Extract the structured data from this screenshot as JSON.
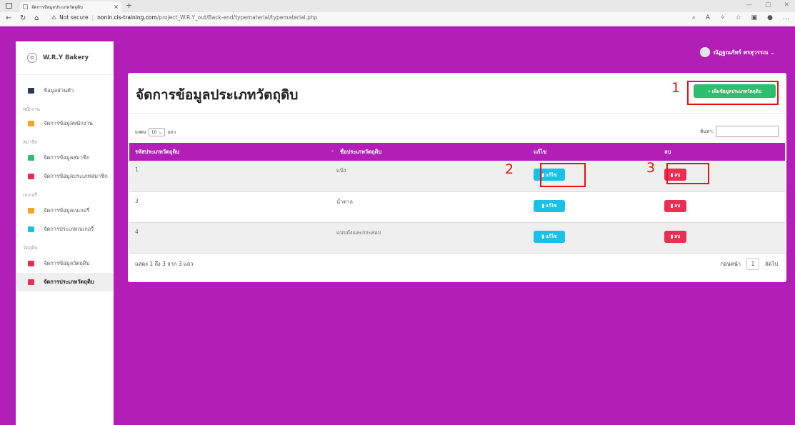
{
  "browser": {
    "tab_title": "จัดการข้อมูลประเภทวัตถุดิบ",
    "tab_close": "×",
    "new_tab": "+",
    "security": "Not secure",
    "url_host": "nonin.cis-training.com",
    "url_path": "/project_W.R.Y_out/Back-end/typematerial/typematerial.php"
  },
  "sidebar": {
    "brand": "W.R.Y Bakery",
    "items": [
      {
        "type": "item",
        "label": "ข้อมูลส่วนตัว",
        "icon": "id-card-icon",
        "color": "#2b3a55"
      },
      {
        "type": "section",
        "label": "พนักงาน"
      },
      {
        "type": "item",
        "label": "จัดการข้อมูลพนักงาน",
        "icon": "user-icon",
        "color": "#f5a623"
      },
      {
        "type": "section",
        "label": "สมาชิก"
      },
      {
        "type": "item",
        "label": "จัดการข้อมูลสมาชิก",
        "icon": "users-icon",
        "color": "#2dbd6e"
      },
      {
        "type": "item",
        "label": "จัดการข้อมูลประเภทสมาชิก",
        "icon": "list-icon",
        "color": "#ea2f52"
      },
      {
        "type": "section",
        "label": "เบเกอรี่"
      },
      {
        "type": "item",
        "label": "จัดการข้อมูลเบเกอรี่",
        "icon": "bakery-icon",
        "color": "#f5a623"
      },
      {
        "type": "item",
        "label": "จัดการประเภทเบเกอรี่",
        "icon": "list-icon",
        "color": "#17c1e8"
      },
      {
        "type": "section",
        "label": "วัตถุดิบ"
      },
      {
        "type": "item",
        "label": "จัดการข้อมูลวัตถุดิบ",
        "icon": "box-icon",
        "color": "#ea2f52"
      },
      {
        "type": "item",
        "label": "จัดการประเภทวัตถุดิบ",
        "icon": "list-icon",
        "color": "#ea2f52",
        "active": true
      }
    ]
  },
  "user": {
    "name": "ณัฏฐณภัทร์ ศรสุวรรณ ⌄"
  },
  "page": {
    "title": "จัดการข้อมูลประเภทวัตถุดิบ",
    "add_button": "+ เพิ่มข้อมูลประเภทวัตถุดิบ",
    "show_label": "แสดง",
    "show_value": "10 ⌄",
    "rows_label": "แถว",
    "search_label": "ค้นหา:",
    "columns": [
      "รหัสประเภทวัตถุดิบ",
      "ชื่อประเภทวัตถุดิบ",
      "แก้ไข",
      "ลบ"
    ],
    "rows": [
      {
        "id": "1",
        "name": "แป้ง"
      },
      {
        "id": "3",
        "name": "น้ำตาล"
      },
      {
        "id": "4",
        "name": "แบบถังและกระสอบ"
      }
    ],
    "edit_label": "แก้ไข",
    "delete_label": "ลบ",
    "info": "แสดง 1 ถึง 3 จาก 3 แถว",
    "prev": "ก่อนหน้า",
    "page_num": "1",
    "next": "ถัดไป"
  },
  "annotations": [
    "1",
    "2",
    "3"
  ]
}
